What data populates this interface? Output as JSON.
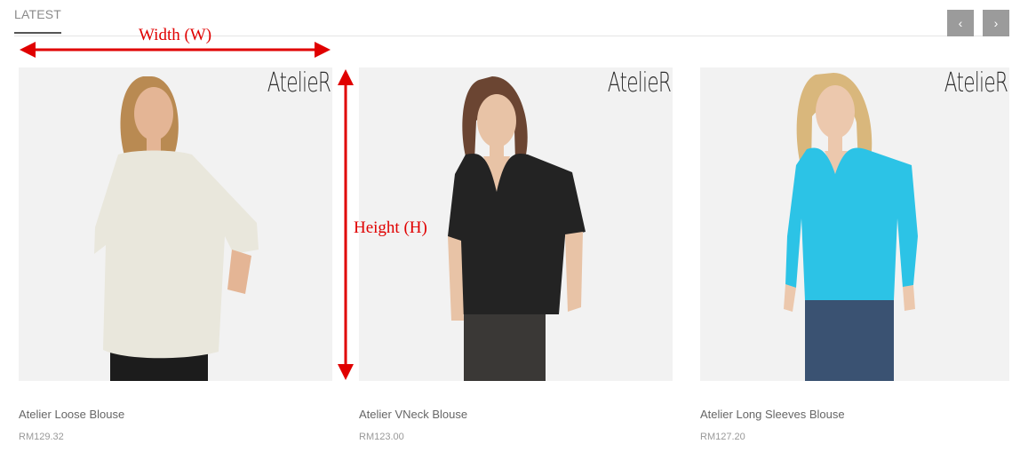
{
  "tabs": {
    "latest_label": "LATEST"
  },
  "nav": {
    "prev_icon": "‹",
    "next_icon": "›"
  },
  "products": [
    {
      "name": "Atelier Loose Blouse",
      "price": "RM129.32",
      "brand": "AtelieR",
      "top_color": "#e9e7dc",
      "bottom_color": "#1c1c1c"
    },
    {
      "name": "Atelier VNeck Blouse",
      "price": "RM123.00",
      "brand": "AtelieR",
      "top_color": "#232323",
      "bottom_color": "#3a3836"
    },
    {
      "name": "Atelier Long Sleeves Blouse",
      "price": "RM127.20",
      "brand": "AtelieR",
      "top_color": "#2cc3e6",
      "bottom_color": "#3a5272"
    }
  ],
  "annotations": {
    "width_label": "Width (W)",
    "height_label": "Height (H)",
    "color": "#e00000"
  }
}
